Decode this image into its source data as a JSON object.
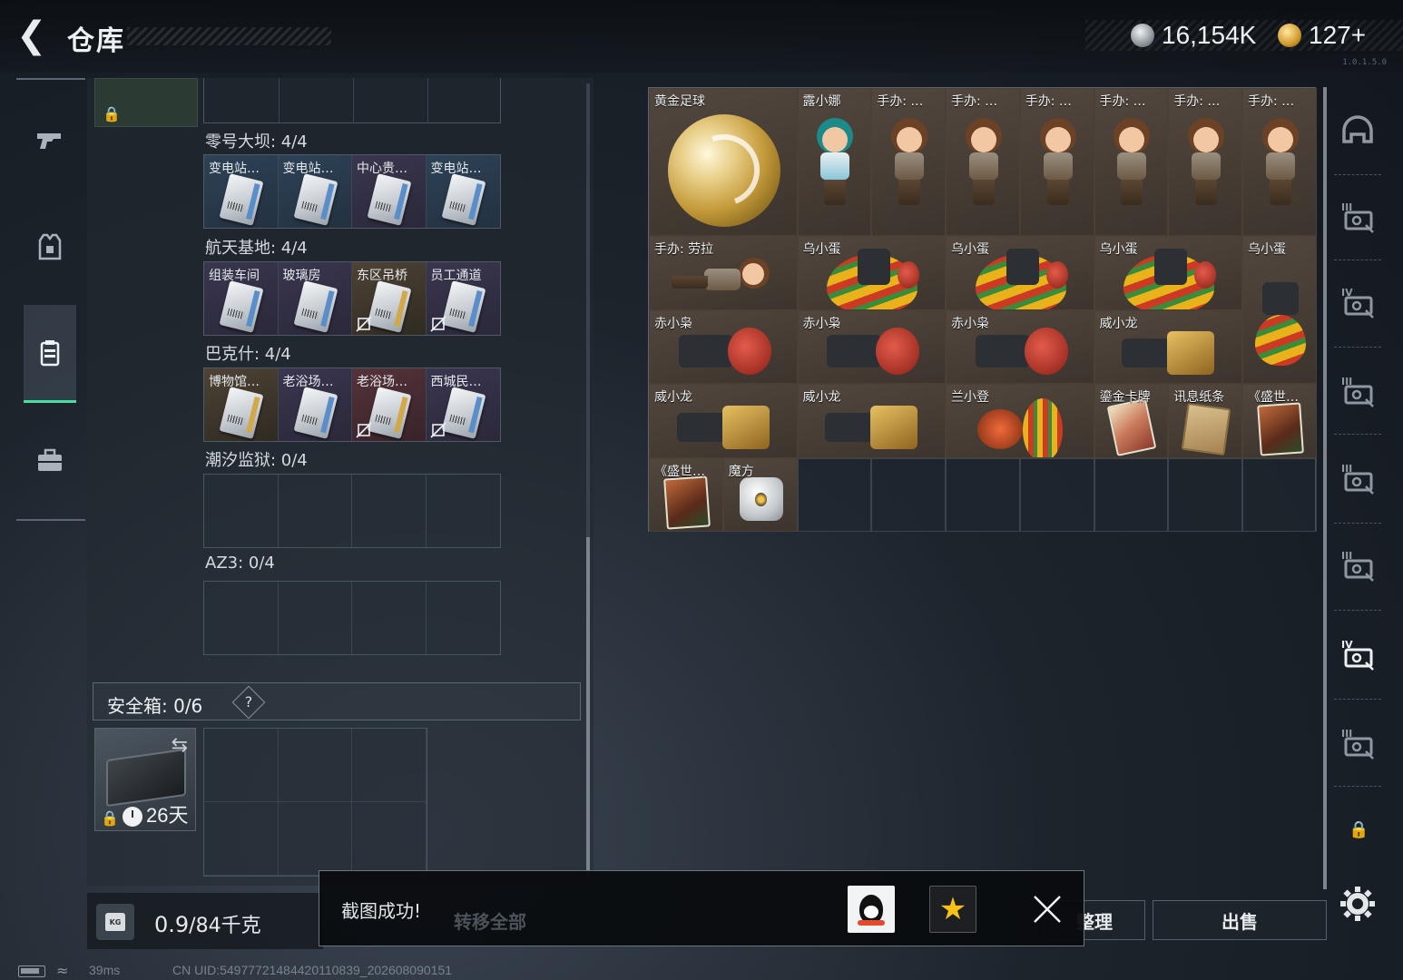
{
  "header": {
    "back_icon": "back-arrow-icon",
    "title": "仓库",
    "currency_silver": "16,154K",
    "currency_gold": "127+",
    "version": "1.0.1.5.0"
  },
  "left_nav": {
    "items": [
      {
        "name": "weapons",
        "icon": "gun-icon"
      },
      {
        "name": "gear",
        "icon": "vest-icon"
      },
      {
        "name": "keys",
        "icon": "keycard-case-icon",
        "active": true
      },
      {
        "name": "containers",
        "icon": "briefcase-icon"
      }
    ]
  },
  "key_regions": [
    {
      "label": "零号大坝: 4/4",
      "cards": [
        {
          "name": "变电站…",
          "rarity": "blue",
          "no_drop": false
        },
        {
          "name": "变电站…",
          "rarity": "blue",
          "no_drop": false
        },
        {
          "name": "中心贵…",
          "rarity": "purple",
          "no_drop": false
        },
        {
          "name": "变电站…",
          "rarity": "blue",
          "no_drop": false
        }
      ]
    },
    {
      "label": "航天基地: 4/4",
      "cards": [
        {
          "name": "组装车间",
          "rarity": "purple",
          "no_drop": false
        },
        {
          "name": "玻璃房",
          "rarity": "purple",
          "no_drop": false
        },
        {
          "name": "东区吊桥",
          "rarity": "gold",
          "no_drop": true
        },
        {
          "name": "员工通道",
          "rarity": "purple",
          "no_drop": true
        }
      ]
    },
    {
      "label": "巴克什: 4/4",
      "cards": [
        {
          "name": "博物馆…",
          "rarity": "gold",
          "no_drop": false
        },
        {
          "name": "老浴场…",
          "rarity": "purple",
          "no_drop": false
        },
        {
          "name": "老浴场…",
          "rarity": "red",
          "no_drop": true
        },
        {
          "name": "西城民…",
          "rarity": "purple",
          "no_drop": true
        }
      ]
    },
    {
      "label": "潮汐监狱: 0/4",
      "cards": []
    },
    {
      "label": "AZ3: 0/4",
      "cards": []
    }
  ],
  "safe_box": {
    "title": "安全箱: 0/6",
    "help": "?",
    "days": "26天"
  },
  "weight": {
    "current": "0.9",
    "max": "/84千克"
  },
  "stash": {
    "items": [
      {
        "name": "黄金足球",
        "art": "gold-ball"
      },
      {
        "name": "露小娜",
        "art": "cap-doll"
      },
      {
        "name": "手办: …",
        "art": "lara-doll"
      },
      {
        "name": "手办: …",
        "art": "lara-doll"
      },
      {
        "name": "手办: …",
        "art": "lara-doll"
      },
      {
        "name": "手办: …",
        "art": "lara-doll"
      },
      {
        "name": "手办: …",
        "art": "lara-doll"
      },
      {
        "name": "手办: …",
        "art": "lara-doll"
      },
      {
        "name": "手办: 劳拉",
        "art": "lara-lying"
      },
      {
        "name": "乌小蛋",
        "art": "egg-bot"
      },
      {
        "name": "乌小蛋",
        "art": "egg-bot"
      },
      {
        "name": "乌小蛋",
        "art": "egg-bot"
      },
      {
        "name": "乌小蛋",
        "art": "egg-bot-tall"
      },
      {
        "name": "赤小枭",
        "art": "red-bot"
      },
      {
        "name": "赤小枭",
        "art": "red-bot"
      },
      {
        "name": "赤小枭",
        "art": "red-bot"
      },
      {
        "name": "威小龙",
        "art": "gold-bot"
      },
      {
        "name": "威小龙",
        "art": "gold-bot"
      },
      {
        "name": "威小龙",
        "art": "gold-bot"
      },
      {
        "name": "兰小登",
        "art": "sombrero-bot"
      },
      {
        "name": "鎏金卡牌",
        "art": "gold-card"
      },
      {
        "name": "讯息纸条",
        "art": "paper-note"
      },
      {
        "name": "《盛世…",
        "art": "painting"
      },
      {
        "name": "《盛世…",
        "art": "painting"
      },
      {
        "name": "魔方",
        "art": "cube"
      }
    ]
  },
  "right_bar": {
    "items": [
      "helmet-icon",
      "tier3-case-icon",
      "tier4-case-icon",
      "tier3-folder-icon",
      "tier3-weapon-icon",
      "tier3-weapon-icon",
      "tier4-case-icon-active",
      "tier3-bag-icon"
    ]
  },
  "actions": {
    "transfer_all": "转移全部",
    "organize": "整理",
    "sell": "出售"
  },
  "toast": {
    "message": "截图成功!",
    "share_qq": "qq-icon",
    "share_qzone": "qzone-star-icon"
  },
  "status": {
    "ping": "39ms",
    "uid": "CN UID:549777214844201108​39_202608090151"
  },
  "colors": {
    "accent": "#45e0a0",
    "rarity_blue": "#2e4257",
    "rarity_purple": "#3a3650",
    "rarity_gold": "#4e4335",
    "rarity_red": "#55333a"
  }
}
